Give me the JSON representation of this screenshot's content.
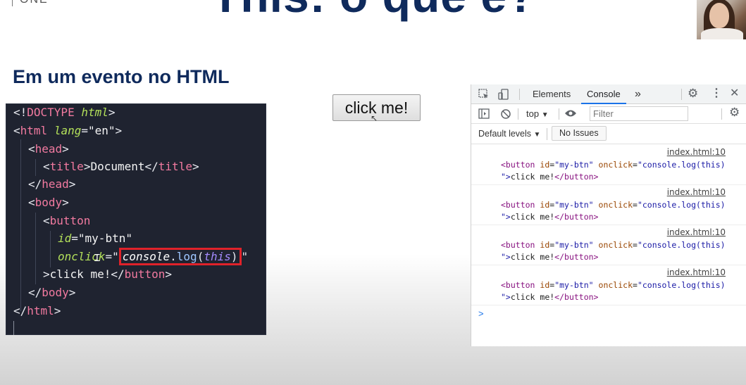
{
  "header": {
    "logo_text": "ONE",
    "slide_title": "This: o que é?",
    "section_heading": "Em um evento no HTML"
  },
  "code_editor": {
    "doctype_open": "<!",
    "doctype_kw": "DOCTYPE",
    "doctype_html": "html",
    "html_tag": "html",
    "lang_attr": "lang",
    "lang_val": "\"en\"",
    "head_tag": "head",
    "title_tag": "title",
    "title_text": "Document",
    "body_tag": "body",
    "button_tag": "button",
    "id_attr": "id",
    "id_val": "\"my-btn\"",
    "onclick_attr": "onclick",
    "highlight_console": "console",
    "highlight_log": "log",
    "highlight_this": "this",
    "button_text": "click me!"
  },
  "demo": {
    "button_label": "click me!"
  },
  "devtools": {
    "tabs": [
      "Elements",
      "Console"
    ],
    "active_tab": "Console",
    "more_tabs": "»",
    "context": "top",
    "filter_placeholder": "Filter",
    "default_levels": "Default levels",
    "issues_button": "No Issues",
    "log_entries": [
      {
        "source": "index.html:10",
        "id_val": "\"my-btn\"",
        "onclick_val": "\"console.log(this)",
        "line2_val": "\">",
        "text": "click me!"
      },
      {
        "source": "index.html:10",
        "id_val": "\"my-btn\"",
        "onclick_val": "\"console.log(this)",
        "line2_val": "\">",
        "text": "click me!"
      },
      {
        "source": "index.html:10",
        "id_val": "\"my-btn\"",
        "onclick_val": "\"console.log(this)",
        "line2_val": "\">",
        "text": "click me!"
      },
      {
        "source": "index.html:10",
        "id_val": "\"my-btn\"",
        "onclick_val": "\"console.log(this)",
        "line2_val": "\">",
        "text": "click me!"
      }
    ],
    "log_tag_open": "<button",
    "log_id_attr": "id",
    "log_onclick_attr": "onclick",
    "log_tag_close": "</button>",
    "prompt": ">"
  },
  "icons": {
    "inspect": "inspect-icon",
    "device": "device-toolbar-icon",
    "settings": "gear-icon",
    "kebab": "more-vert-icon",
    "close": "close-icon",
    "sidebar": "sidebar-toggle-icon",
    "clear": "clear-console-icon",
    "eye": "live-expression-icon"
  },
  "colors": {
    "title": "#0f2a5c",
    "code_bg": "#1f2330",
    "highlight_border": "#e0222a",
    "devtools_accent": "#1a73e8"
  }
}
